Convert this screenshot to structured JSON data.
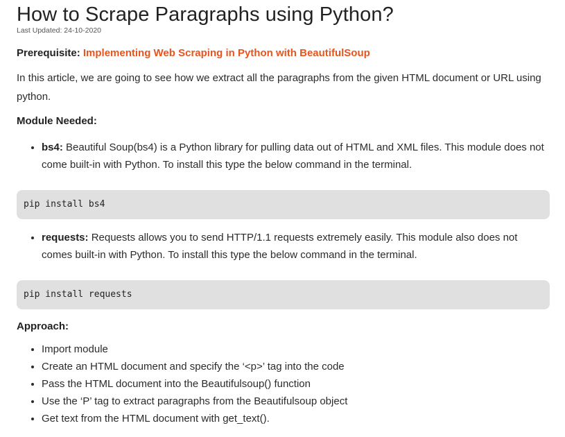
{
  "article": {
    "title": "How to Scrape Paragraphs using Python?",
    "last_updated": "Last Updated: 24-10-2020",
    "prerequisite_label": "Prerequisite: ",
    "prerequisite_link": "Implementing Web Scraping in Python with BeautifulSoup",
    "intro": "In this article, we are going to see how we extract all the paragraphs from the given HTML document or URL using python.",
    "module_heading": "Module Needed:",
    "modules": [
      {
        "name": "bs4:",
        "description": " Beautiful Soup(bs4) is a Python library for pulling data out of HTML and XML files. This module does not come built-in with Python. To install this type the below command in the terminal."
      },
      {
        "name": "requests:",
        "description": "  Requests allows you to send HTTP/1.1 requests extremely easily. This module also does not comes built-in with Python. To install this type the below command in the terminal."
      }
    ],
    "code_blocks": [
      "pip install bs4",
      "pip install requests"
    ],
    "approach_heading": "Approach:",
    "approach_steps": [
      "Import module",
      "Create an HTML document and specify the ‘<p>’ tag into the code",
      "Pass the HTML document into the Beautifulsoup() function",
      "Use the ‘P’ tag to extract paragraphs from the Beautifulsoup object",
      "Get text from the HTML document with get_text()."
    ]
  },
  "colors": {
    "link": "#e8541e",
    "code_bg": "#e0e0e0",
    "text": "#2b2b2b"
  }
}
